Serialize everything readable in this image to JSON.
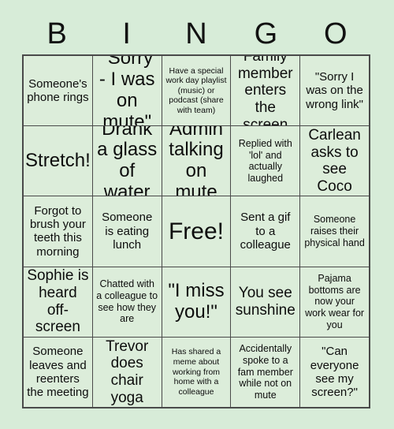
{
  "card": {
    "title_letters": [
      "B",
      "I",
      "N",
      "G",
      "O"
    ],
    "background_color": "#d7ecd8",
    "cell_color": "#dcedda",
    "border_color": "#4a4a4a",
    "text_color": "#0d0d0d"
  },
  "rows": [
    {
      "cells": [
        {
          "text": "Someone's phone rings",
          "size": "m"
        },
        {
          "text": "\"Sorry - I was on mute\"",
          "size": "xl"
        },
        {
          "text": "Have a special work day playlist (music) or podcast (share with team)",
          "size": "xs"
        },
        {
          "text": "Family member enters the screen",
          "size": "l"
        },
        {
          "text": "\"Sorry I was on the wrong link\"",
          "size": "m"
        }
      ]
    },
    {
      "cells": [
        {
          "text": "Stretch!",
          "size": "xl"
        },
        {
          "text": "Drank a glass of water",
          "size": "xl"
        },
        {
          "text": "Admin talking on mute",
          "size": "xl"
        },
        {
          "text": "Replied with 'lol' and actually laughed",
          "size": "s"
        },
        {
          "text": "Carlean asks to see Coco",
          "size": "l"
        }
      ]
    },
    {
      "cells": [
        {
          "text": "Forgot to brush your teeth this morning",
          "size": "m"
        },
        {
          "text": "Someone is eating lunch",
          "size": "m"
        },
        {
          "text": "Free!",
          "size": "free"
        },
        {
          "text": "Sent a gif to a colleague",
          "size": "m"
        },
        {
          "text": "Someone raises their physical hand",
          "size": "s"
        }
      ]
    },
    {
      "cells": [
        {
          "text": "Sophie is heard off-screen",
          "size": "l"
        },
        {
          "text": "Chatted with a colleague to see how they are",
          "size": "s"
        },
        {
          "text": "\"I miss you!\"",
          "size": "xl"
        },
        {
          "text": "You see sunshine",
          "size": "l"
        },
        {
          "text": "Pajama bottoms are now your work wear for you",
          "size": "s"
        }
      ]
    },
    {
      "cells": [
        {
          "text": "Someone leaves and reenters the meeting",
          "size": "m"
        },
        {
          "text": "Trevor does chair yoga",
          "size": "l"
        },
        {
          "text": "Has shared a meme about working from home with a colleague",
          "size": "xs"
        },
        {
          "text": "Accidentally spoke to a fam member while not on mute",
          "size": "s"
        },
        {
          "text": "\"Can everyone see my screen?\"",
          "size": "m"
        }
      ]
    }
  ]
}
